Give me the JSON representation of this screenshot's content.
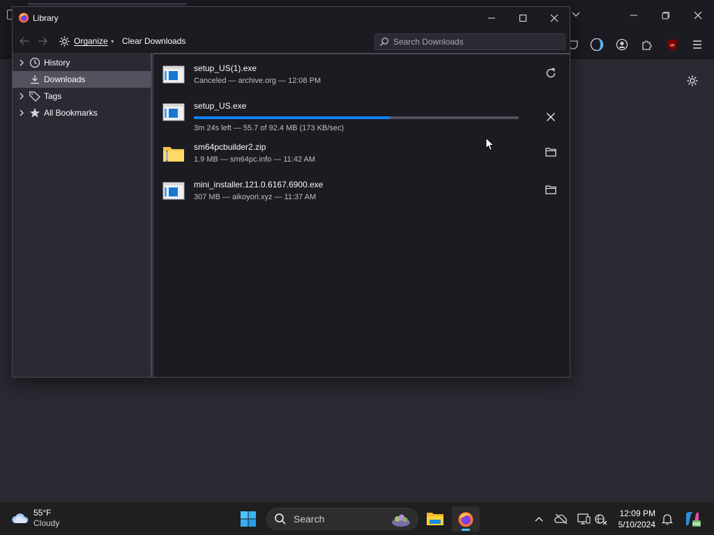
{
  "library": {
    "title": "Library",
    "toolbar": {
      "organize_label": "Organize",
      "clear_downloads_label": "Clear Downloads",
      "search_placeholder": "Search Downloads"
    },
    "sidebar": {
      "items": [
        {
          "label": "History",
          "icon": "clock-icon",
          "expandable": true
        },
        {
          "label": "Downloads",
          "icon": "download-icon",
          "selected": true
        },
        {
          "label": "Tags",
          "icon": "tag-icon",
          "expandable": true
        },
        {
          "label": "All Bookmarks",
          "icon": "star-icon",
          "expandable": true
        }
      ]
    },
    "downloads": [
      {
        "name": "setup_US(1).exe",
        "status": "Canceled — archive.org — 12:08 PM",
        "icon": "exe-file-icon",
        "action": "retry-icon"
      },
      {
        "name": "setup_US.exe",
        "status": "3m 24s left — 55.7 of 92.4 MB (173 KB/sec)",
        "icon": "exe-file-icon",
        "action": "cancel-icon",
        "progress": 0.603
      },
      {
        "name": "sm64pcbuilder2.zip",
        "status": "1.9 MB — sm64pc.info — 11:42 AM",
        "icon": "zip-folder-icon",
        "action": "folder-icon"
      },
      {
        "name": "mini_installer.121.0.6167.6900.exe",
        "status": "307 MB — aikoyori.xyz — 11:37 AM",
        "icon": "exe-file-icon",
        "action": "folder-icon"
      }
    ]
  },
  "taskbar": {
    "weather": {
      "temp": "55°F",
      "condition": "Cloudy"
    },
    "search_label": "Search",
    "clock": {
      "time": "12:09 PM",
      "date": "5/10/2024"
    }
  },
  "colors": {
    "accent": "#0a84ff",
    "dialog_bg": "#2b2a33",
    "list_bg": "#1c1b22",
    "selected_bg": "#52525e"
  }
}
